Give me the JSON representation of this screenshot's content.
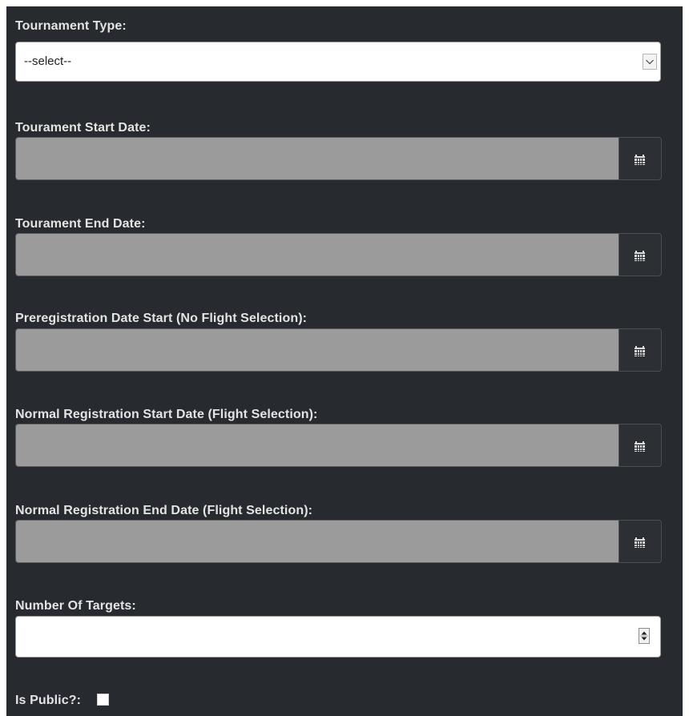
{
  "form": {
    "tournament_type": {
      "label": "Tournament Type:",
      "selected": "--select--",
      "icon": "chevron-down-icon"
    },
    "start_date": {
      "label": "Tourament Start Date:",
      "value": "",
      "icon": "calendar-icon"
    },
    "end_date": {
      "label": "Tourament End Date:",
      "value": "",
      "icon": "calendar-icon"
    },
    "prereg_start": {
      "label": "Preregistration Date Start (No Flight Selection):",
      "value": "",
      "icon": "calendar-icon"
    },
    "normal_reg_start": {
      "label": "Normal Registration Start Date (Flight Selection):",
      "value": "",
      "icon": "calendar-icon"
    },
    "normal_reg_end": {
      "label": "Normal Registration End Date (Flight Selection):",
      "value": "",
      "icon": "calendar-icon"
    },
    "number_of_targets": {
      "label": "Number Of Targets:",
      "value": "",
      "icon": "spinner-icon"
    },
    "is_public": {
      "label": "Is Public?:",
      "checked": false
    }
  },
  "colors": {
    "background": "#272a2e",
    "label": "#e4e4e4",
    "disabled_input": "#9b9b9b",
    "input": "#ffffff"
  }
}
